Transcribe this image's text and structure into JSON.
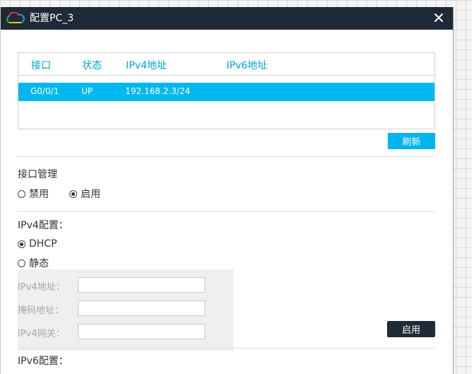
{
  "window": {
    "title": "配置PC_3"
  },
  "interface_table": {
    "headers": [
      "接口",
      "状态",
      "IPv4地址",
      "IPv6地址"
    ],
    "rows": [
      [
        "G0/0/1",
        "UP",
        "192.168.2.3/24",
        ""
      ]
    ]
  },
  "buttons": {
    "refresh": "刷新",
    "apply": "启用"
  },
  "interface_management": {
    "label": "接口管理",
    "options": [
      "禁用",
      "启用"
    ],
    "selected": "启用"
  },
  "ipv4_config": {
    "label": "IPv4配置：",
    "options": [
      "DHCP",
      "静态"
    ],
    "selected": "DHCP",
    "fields": [
      {
        "label": "IPv4地址：",
        "value": ""
      },
      {
        "label": "掩码地址：",
        "value": ""
      },
      {
        "label": "IPv4网关：",
        "value": ""
      }
    ]
  },
  "ipv6_config": {
    "label": "IPv6配置："
  },
  "colors": {
    "accent": "#00b4ef",
    "titlebar": "#1e2a36",
    "header_text": "#00a2d6"
  },
  "icons": {
    "logo": "cloud-logo-icon",
    "close": "close-icon"
  }
}
